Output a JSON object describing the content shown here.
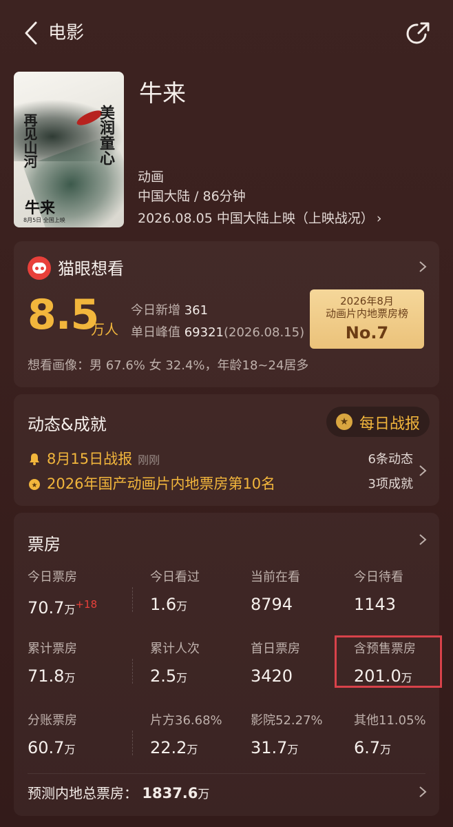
{
  "header": {
    "back_label": "电影"
  },
  "movie": {
    "title": "牛来",
    "genre": "动画",
    "region_duration": "中国大陆 / 86分钟",
    "release": "2026.08.05 中国大陆上映（上映战况）",
    "poster": {
      "left_text": "再见山河",
      "right_text": "美润童心",
      "name": "牛来",
      "date_line": "8月5日 全国上映"
    }
  },
  "want": {
    "title": "猫眼想看",
    "number": "8.5",
    "unit": "万人",
    "today_new_label": "今日新增",
    "today_new_value": "361",
    "peak_label": "单日峰值",
    "peak_value": "69321",
    "peak_date": "(2026.08.15)",
    "rank_line1": "2026年8月",
    "rank_line2": "动画片内地票房榜",
    "rank_value": "No.7",
    "profile": "想看画像：男 67.6%  女 32.4%，年龄18~24居多"
  },
  "dynamics": {
    "title": "动态&成就",
    "daily_report": "每日战报",
    "row1_text": "8月15日战报",
    "row1_sub": "刚刚",
    "row1_right": "6条动态",
    "row2_text": "2026年国产动画片内地票房第10名",
    "row2_right": "3项成就"
  },
  "boxoffice": {
    "title": "票房",
    "rows": [
      [
        {
          "label": "今日票房",
          "value": "70.7",
          "unit": "万",
          "delta": "+18"
        },
        {
          "label": "今日看过",
          "value": "1.6",
          "unit": "万"
        },
        {
          "label": "当前在看",
          "value": "8794",
          "unit": ""
        },
        {
          "label": "今日待看",
          "value": "1143",
          "unit": ""
        }
      ],
      [
        {
          "label": "累计票房",
          "value": "71.8",
          "unit": "万"
        },
        {
          "label": "累计人次",
          "value": "2.5",
          "unit": "万"
        },
        {
          "label": "首日票房",
          "value": "3420",
          "unit": ""
        },
        {
          "label": "含预售票房",
          "value": "201.0",
          "unit": "万"
        }
      ],
      [
        {
          "label": "分账票房",
          "value": "60.7",
          "unit": "万"
        },
        {
          "label": "片方36.68%",
          "value": "22.2",
          "unit": "万"
        },
        {
          "label": "影院52.27%",
          "value": "31.7",
          "unit": "万"
        },
        {
          "label": "其他11.05%",
          "value": "6.7",
          "unit": "万"
        }
      ]
    ],
    "forecast_label": "预测内地总票房：",
    "forecast_value": "1837.6",
    "forecast_unit": "万"
  },
  "colors": {
    "accent": "#f2b63c",
    "delta": "#e8403a",
    "highlight": "#d8424a"
  }
}
